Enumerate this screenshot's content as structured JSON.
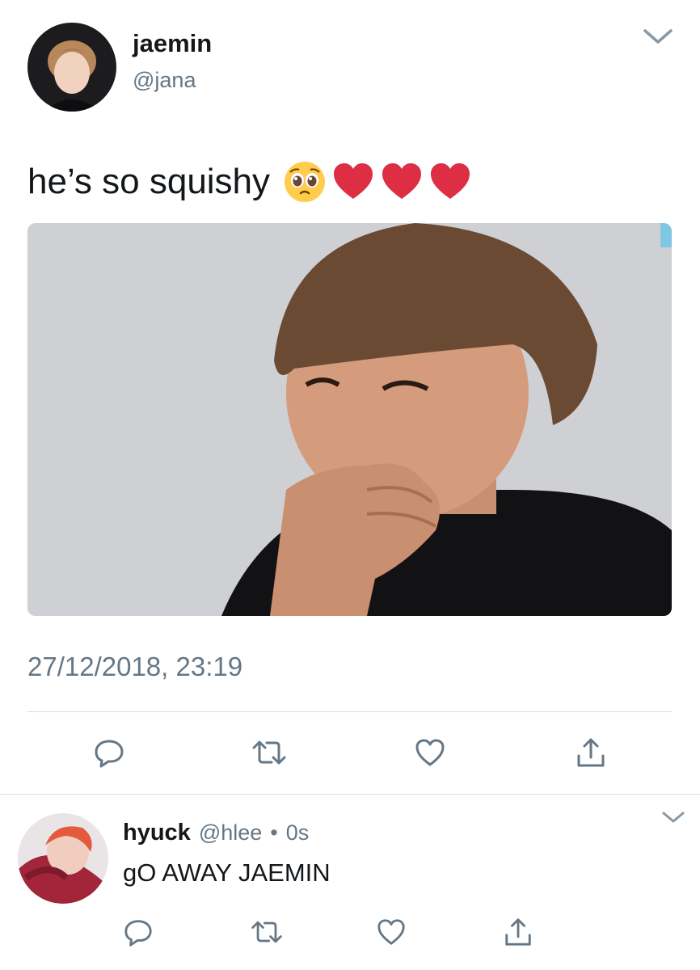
{
  "tweet": {
    "display_name": "jaemin",
    "handle": "@jana",
    "text": "he’s so squishy",
    "emojis": [
      "pleading-face-emoji",
      "red-heart-emoji",
      "red-heart-emoji",
      "red-heart-emoji"
    ],
    "timestamp": "27/12/2018, 23:19"
  },
  "reply": {
    "display_name": "hyuck",
    "handle": "@hlee",
    "separator": "•",
    "time": "0s",
    "text": "gO AWAY JAEMIN"
  },
  "icons": [
    "chevron-down-icon",
    "reply-icon",
    "retweet-icon",
    "like-icon",
    "share-icon"
  ],
  "colors": {
    "secondary_text": "#657786",
    "divider": "#d9dde1",
    "icon": "#657786"
  }
}
